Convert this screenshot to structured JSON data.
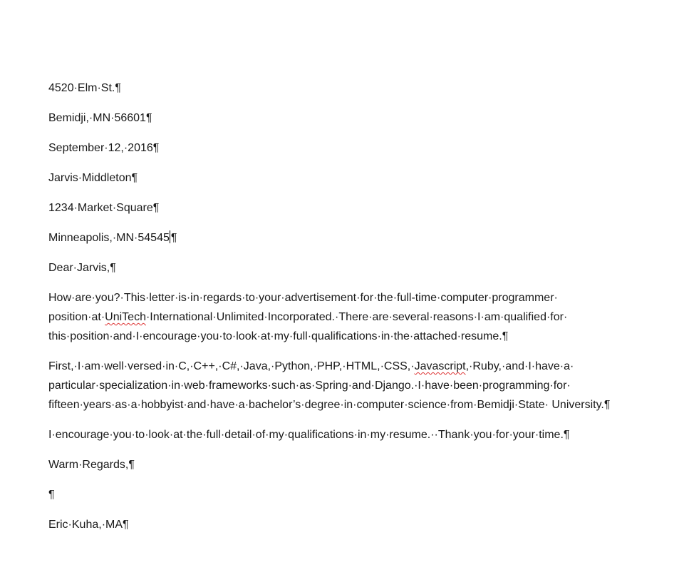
{
  "document": {
    "paragraphs": [
      {
        "id": "sender-street",
        "text": "4520·Elm·St.¶"
      },
      {
        "id": "sender-city",
        "text": "Bemidji,·MN·56601¶"
      },
      {
        "id": "date",
        "text": "September·12,·2016¶"
      },
      {
        "id": "recipient-name",
        "text": "Jarvis·Middleton¶"
      },
      {
        "id": "recipient-street",
        "text": "1234·Market·Square¶"
      },
      {
        "id": "recipient-city-before-cursor",
        "text": "Minneapolis,·MN·54545"
      },
      {
        "id": "recipient-city-after-cursor",
        "text": "¶"
      },
      {
        "id": "salutation",
        "text": "Dear·Jarvis,¶"
      }
    ],
    "body1": {
      "part1": "How·are·you?·This·letter·is·in·regards·to·your·advertisement·for·the·full-time·computer·programmer· position·at·",
      "misspelled": "UniTech",
      "part2": "·International·Unlimited·Incorporated.·There·are·several·reasons·I·am·qualified·for· this·position·and·I·encourage·you·to·look·at·my·full·qualifications·in·the·attached·resume.¶"
    },
    "body2": {
      "part1": "First,·I·am·well·versed·in·C,·C++,·C#,·Java,·Python,·PHP,·HTML,·CSS,·",
      "misspelled": "Javascript",
      "part2": ",·Ruby,·and·I·have·a· particular·specialization·in·web·frameworks·such·as·Spring·and·Django.·I·have·been·programming·for· fifteen·years·as·a·hobbyist·and·have·a·bachelor’s·degree·in·computer·science·from·Bemidji·State· University.¶"
    },
    "body3": "I·encourage·you·to·look·at·the·full·detail·of·my·qualifications·in·my·resume.··Thank·you·for·your·time.¶",
    "closing": "Warm·Regards,¶",
    "blank": "¶",
    "signature": "Eric·Kuha,·MA¶"
  },
  "colors": {
    "text": "#1a1a1a",
    "spell_underline": "#d33",
    "background": "#ffffff"
  }
}
